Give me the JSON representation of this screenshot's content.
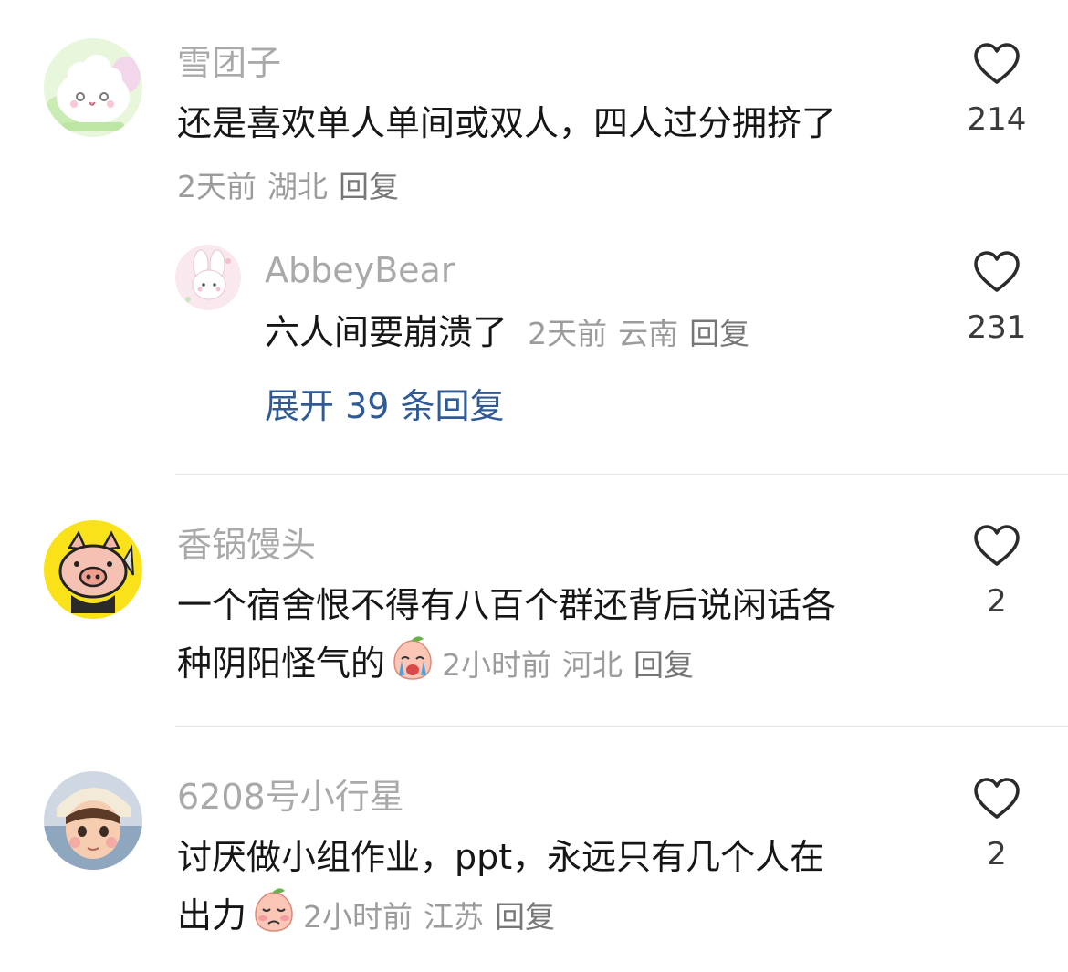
{
  "comments": [
    {
      "username": "雪团子",
      "text_lines": [
        "还是喜欢单人单间或双人，四人过分拥挤了"
      ],
      "time": "2天前",
      "location": "湖北",
      "reply_label": "回复",
      "like_count": "214",
      "avatar": "snow-bun-avatar"
    },
    {
      "username": "香锅馒头",
      "text_lines": [
        "一个宿舍恨不得有八百个群还背后说闲话各",
        "种阴阳怪气的"
      ],
      "emoji": "crying-peach-emoji",
      "time": "2小时前",
      "location": "河北",
      "reply_label": "回复",
      "like_count": "2",
      "avatar": "pig-face-avatar"
    },
    {
      "username": "6208号小行星",
      "text_lines": [
        "讨厌做小组作业，ppt，永远只有几个人在",
        "出力"
      ],
      "emoji": "sad-peach-emoji",
      "time": "2小时前",
      "location": "江苏",
      "reply_label": "回复",
      "like_count": "2",
      "avatar": "boy-portrait-avatar"
    }
  ],
  "reply": {
    "username": "AbbeyBear",
    "text": "六人间要崩溃了",
    "time": "2天前",
    "location": "云南",
    "reply_label": "回复",
    "like_count": "231",
    "avatar": "bunny-avatar"
  },
  "expand_replies": "展开 39 条回复",
  "colors": {
    "username": "#a9a9a9",
    "meta": "#9c9c9c",
    "link": "#2f5a95",
    "divider": "#e6e6e6"
  }
}
